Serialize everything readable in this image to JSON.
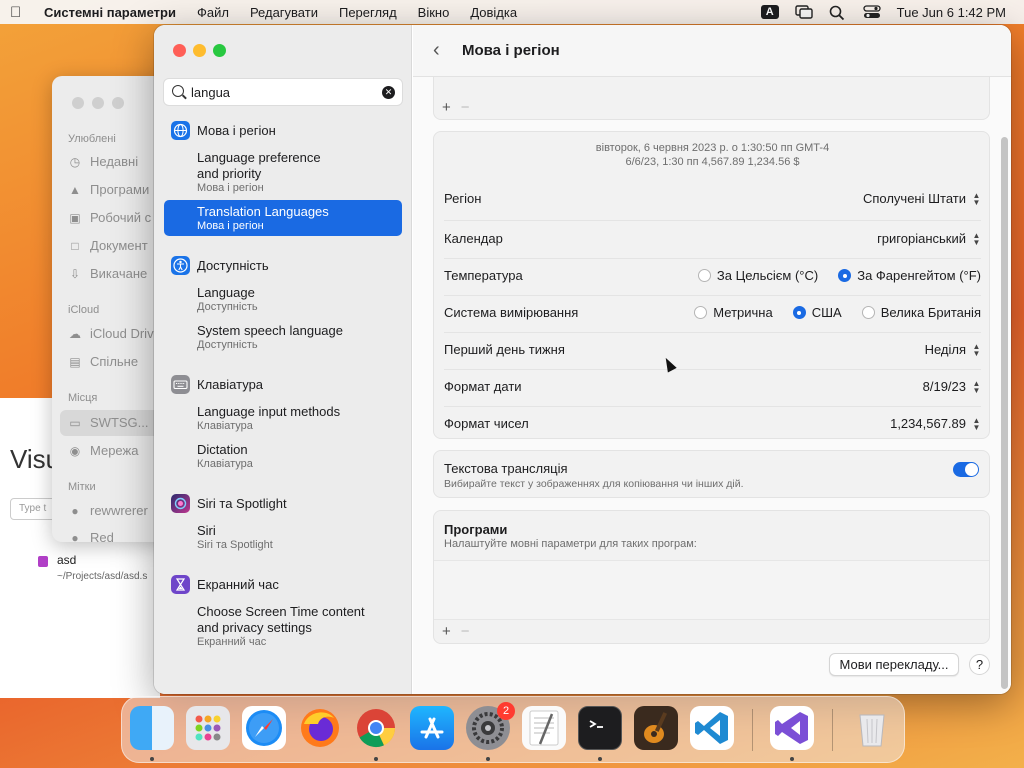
{
  "menubar": {
    "app_name": "Системні параметри",
    "items": [
      "Файл",
      "Редагувати",
      "Перегляд",
      "Вікно",
      "Довідка"
    ],
    "input_source": "A",
    "datetime": "Tue Jun 6  1:42 PM"
  },
  "desktop": {
    "visual_text": "Visu",
    "type_placeholder": "Type t",
    "file_name": "asd",
    "file_path": "~/Projects/asd/asd.s"
  },
  "finder": {
    "favorites_header": "Улюблені",
    "favorites": [
      "Недавні",
      "Програми",
      "Робочий с",
      "Документ",
      "Викачане"
    ],
    "icloud_header": "iCloud",
    "icloud": [
      "iCloud Driv",
      "Спільне"
    ],
    "locations_header": "Місця",
    "locations": [
      "SWTSG...",
      "Мережа"
    ],
    "tags_header": "Мітки",
    "tags": [
      "rewwrerer",
      "Red"
    ]
  },
  "sidebar": {
    "search_value": "langua",
    "groups": [
      {
        "category": "Мова і регіон",
        "icon": "globe-icon",
        "color": "#1a73e8",
        "results": [
          {
            "title_line1": "Language preference",
            "title_line2": "and priority",
            "subtitle": "Мова і регіон"
          },
          {
            "title_line1": "Translation Languages",
            "subtitle": "Мова і регіон",
            "selected": true
          }
        ]
      },
      {
        "category": "Доступність",
        "icon": "accessibility-icon",
        "color": "#1a73e8",
        "results": [
          {
            "title_line1": "Language",
            "subtitle": "Доступність"
          },
          {
            "title_line1": "System speech language",
            "subtitle": "Доступність"
          }
        ]
      },
      {
        "category": "Клавіатура",
        "icon": "keyboard-icon",
        "color": "#8e8e93",
        "results": [
          {
            "title_line1": "Language input methods",
            "subtitle": "Клавіатура"
          },
          {
            "title_line1": "Dictation",
            "subtitle": "Клавіатура"
          }
        ]
      },
      {
        "category": "Siri та Spotlight",
        "icon": "siri-icon",
        "color": "#6b3cd6",
        "results": [
          {
            "title_line1": "Siri",
            "subtitle": "Siri та Spotlight"
          }
        ]
      },
      {
        "category": "Екранний час",
        "icon": "hourglass-icon",
        "color": "#6e45c9",
        "results": [
          {
            "title_line1": "Choose Screen Time content",
            "title_line2": "and privacy settings",
            "subtitle": "Екранний час"
          }
        ]
      }
    ]
  },
  "main": {
    "title": "Мова і регіон",
    "preview_line1": "вівторок, 6 червня 2023 р. о 1:30:50 пп GMT-4",
    "preview_line2": "6/6/23, 1:30 пп      4,567.89      1,234.56 $",
    "region": {
      "label": "Регіон",
      "value": "Сполучені Штати"
    },
    "calendar": {
      "label": "Календар",
      "value": "григоріанський"
    },
    "temperature": {
      "label": "Температура",
      "options": [
        "За Цельсієм (°C)",
        "За Фаренгейтом (°F)"
      ],
      "selected": 1
    },
    "measurement": {
      "label": "Система вимірювання",
      "options": [
        "Метрична",
        "США",
        "Велика Британія"
      ],
      "selected": 1
    },
    "first_day": {
      "label": "Перший день тижня",
      "value": "Неділя"
    },
    "date_format": {
      "label": "Формат дати",
      "value": "8/19/23"
    },
    "number_format": {
      "label": "Формат чисел",
      "value": "1,234,567.89"
    },
    "live_text": {
      "title": "Текстова трансляція",
      "description": "Вибирайте текст у зображеннях для копіювання чи інших дій.",
      "enabled": true
    },
    "apps": {
      "title": "Програми",
      "description": "Налаштуйте мовні параметри для таких програм:"
    },
    "translation_button": "Мови перекладу...",
    "help_label": "?",
    "plus": "+",
    "minus": "−"
  },
  "dock": {
    "apps": [
      "Finder",
      "Launchpad",
      "Safari",
      "Firefox",
      "Chrome",
      "App Store",
      "System Settings",
      "TextEdit",
      "Terminal",
      "GarageBand",
      "VS Code",
      "Visual Studio",
      "Trash"
    ],
    "settings_badge": "2"
  }
}
